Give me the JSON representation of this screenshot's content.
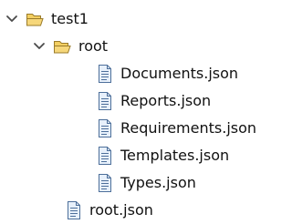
{
  "tree": {
    "project": {
      "label": "test1",
      "icon": "open-folder-icon",
      "expanded": true
    },
    "folder": {
      "label": "root",
      "icon": "open-folder-icon",
      "expanded": true,
      "files": [
        {
          "label": "Documents.json",
          "icon": "json-file-icon"
        },
        {
          "label": "Reports.json",
          "icon": "json-file-icon"
        },
        {
          "label": "Requirements.json",
          "icon": "json-file-icon"
        },
        {
          "label": "Templates.json",
          "icon": "json-file-icon"
        },
        {
          "label": "Types.json",
          "icon": "json-file-icon"
        }
      ]
    },
    "root_file": {
      "label": "root.json",
      "icon": "json-file-icon"
    }
  },
  "colors": {
    "folder_fill": "#f6d77a",
    "folder_stroke": "#9a7b2a",
    "file_fill": "#e7f0fb",
    "file_stroke": "#4d6f9a",
    "chevron": "#4a4a4a"
  }
}
